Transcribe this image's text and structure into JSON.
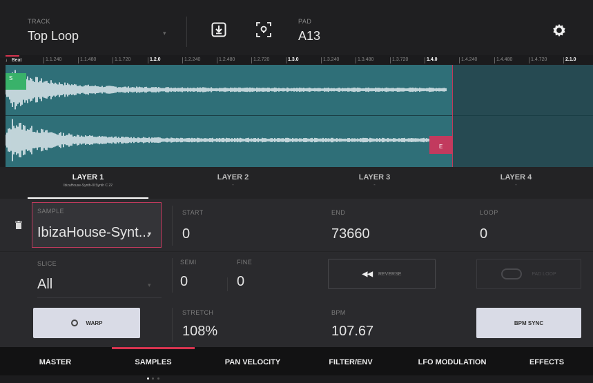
{
  "header": {
    "track_label": "TRACK",
    "track_value": "Top Loop",
    "pad_label": "PAD",
    "pad_value": "A13"
  },
  "ruler": {
    "unit": "Beat",
    "ticks": [
      "1.1.240",
      "1.1.480",
      "1.1.720",
      "1.2.0",
      "1.2.240",
      "1.2.480",
      "1.2.720",
      "1.3.0",
      "1.3.240",
      "1.3.480",
      "1.3.720",
      "1.4.0",
      "1.4.240",
      "1.4.480",
      "1.4.720",
      "2.1.0"
    ]
  },
  "waveform": {
    "start_marker": "S",
    "end_marker": "E",
    "colors": {
      "selected": "#2f6f78",
      "unselected": "#264a52",
      "start": "#39b26a",
      "end": "#c23a5e"
    }
  },
  "layers": [
    {
      "name": "LAYER 1",
      "sample": "IbizaHouse-Synth-Ill Synth C 22",
      "active": true
    },
    {
      "name": "LAYER 2",
      "sample": "-"
    },
    {
      "name": "LAYER 3",
      "sample": "-"
    },
    {
      "name": "LAYER 4",
      "sample": "-"
    }
  ],
  "params": {
    "sample_label": "SAMPLE",
    "sample_value": "IbizaHouse-Synt...",
    "start_label": "START",
    "start_value": "0",
    "end_label": "END",
    "end_value": "73660",
    "loop_label": "LOOP",
    "loop_value": "0",
    "slice_label": "SLICE",
    "slice_value": "All",
    "semi_label": "SEMI",
    "semi_value": "0",
    "fine_label": "FINE",
    "fine_value": "0",
    "reverse_label": "REVERSE",
    "pad_loop_label": "PAD LOOP",
    "warp_label": "WARP",
    "stretch_label": "STRETCH",
    "stretch_value": "108%",
    "bpm_label": "BPM",
    "bpm_value": "107.67",
    "bpm_sync_label": "BPM SYNC"
  },
  "tabs": [
    {
      "label": "MASTER"
    },
    {
      "label": "SAMPLES",
      "active": true
    },
    {
      "label": "PAN VELOCITY"
    },
    {
      "label": "FILTER/ENV"
    },
    {
      "label": "LFO MODULATION"
    },
    {
      "label": "EFFECTS"
    }
  ],
  "colors": {
    "accent": "#d8344f",
    "button_light": "#d9dbe6"
  }
}
